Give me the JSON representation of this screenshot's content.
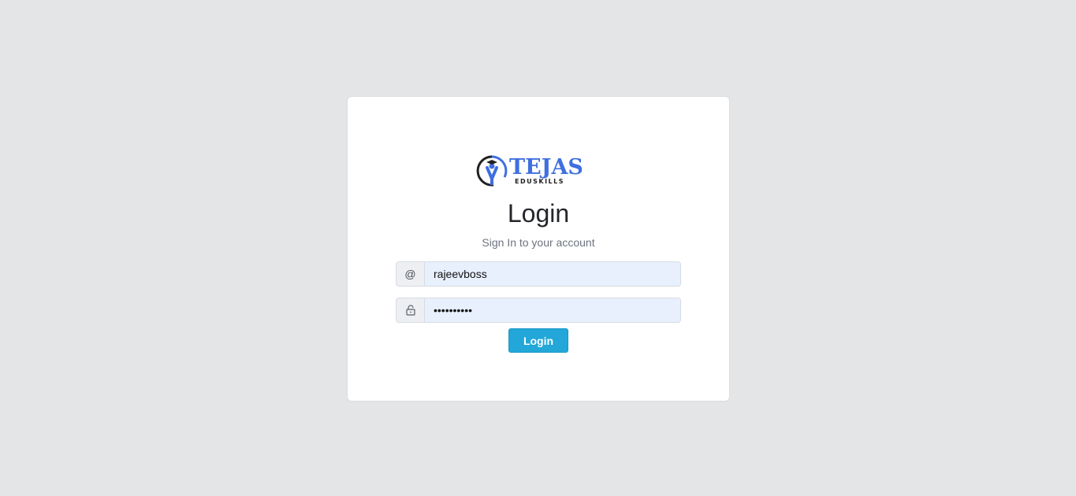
{
  "brand": {
    "name": "TEJAS",
    "tagline": "EDUSKILLS",
    "accent_color": "#3f6fe0",
    "logo_icon": "graduate-figure-icon"
  },
  "login": {
    "title": "Login",
    "subtitle": "Sign In to your account",
    "username": {
      "icon": "at-icon",
      "icon_glyph": "@",
      "value": "rajeevboss"
    },
    "password": {
      "icon": "lock-icon",
      "value": "••••••••••"
    },
    "submit_label": "Login",
    "button_color": "#22a7d8"
  }
}
